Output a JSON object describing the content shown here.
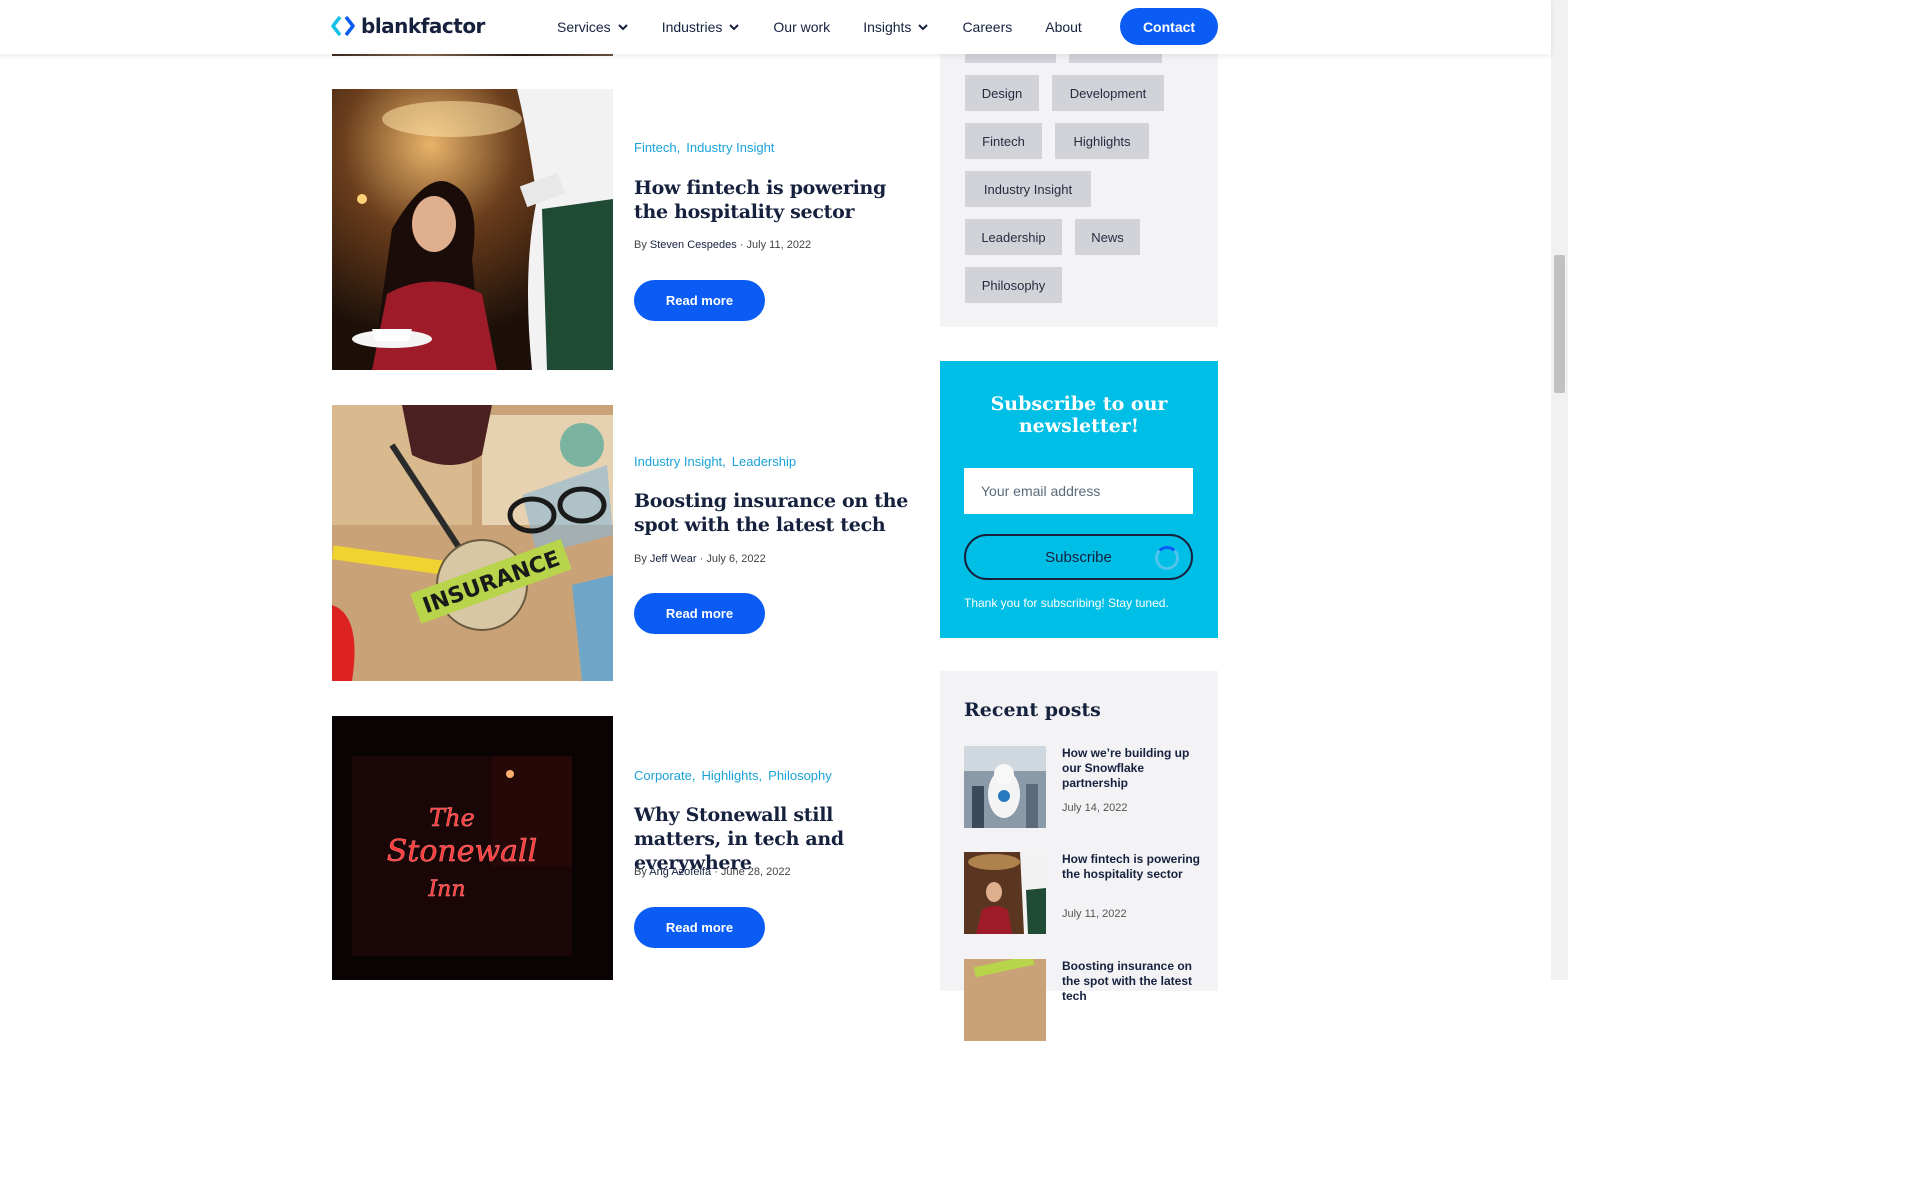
{
  "header": {
    "logo_text": "blankfactor",
    "nav": [
      {
        "label": "Services",
        "has_dropdown": true
      },
      {
        "label": "Industries",
        "has_dropdown": true
      },
      {
        "label": "Our work",
        "has_dropdown": false
      },
      {
        "label": "Insights",
        "has_dropdown": true
      },
      {
        "label": "Careers",
        "has_dropdown": false
      },
      {
        "label": "About",
        "has_dropdown": false
      }
    ],
    "contact_label": "Contact"
  },
  "posts": [
    {
      "categories": [
        "Fintech",
        "Industry Insight"
      ],
      "title": "How fintech is powering the hospitality sector",
      "by": "By",
      "author": "Steven Cespedes",
      "date": "July 11, 2022",
      "read_more": "Read more"
    },
    {
      "categories": [
        "Industry Insight",
        "Leadership"
      ],
      "title": "Boosting insurance on the spot with the latest tech",
      "by": "By",
      "author": "Jeff Wear",
      "date": "July 6, 2022",
      "read_more": "Read more",
      "image_text": "INSURANCE"
    },
    {
      "categories": [
        "Corporate",
        "Highlights",
        "Philosophy"
      ],
      "title": "Why Stonewall still matters, in tech and everywhere",
      "by": "By",
      "author": "Ang Azofeifa",
      "date": "June 28, 2022",
      "read_more": "Read more",
      "image_text": [
        "The",
        "Stonewall",
        "Inn"
      ]
    }
  ],
  "sidebar": {
    "tags": [
      "Design",
      "Development",
      "Fintech",
      "Highlights",
      "Industry Insight",
      "Leadership",
      "News",
      "Philosophy"
    ],
    "newsletter": {
      "title": "Subscribe to our newsletter!",
      "email_placeholder": "Your email address",
      "button_label": "Subscribe",
      "thanks": "Thank you for subscribing! Stay tuned."
    },
    "recent": {
      "title": "Recent posts",
      "items": [
        {
          "title": "How we’re building up our Snowflake partnership",
          "date": "July 14, 2022"
        },
        {
          "title": "How fintech is powering the hospitality sector",
          "date": "July 11, 2022"
        },
        {
          "title": "Boosting insurance on the spot with the latest tech",
          "date": ""
        }
      ]
    }
  },
  "colors": {
    "brand_blue": "#0a5cf5",
    "accent_cyan": "#00bfe6",
    "category_text": "#1aa3d9",
    "navy": "#16213e"
  }
}
